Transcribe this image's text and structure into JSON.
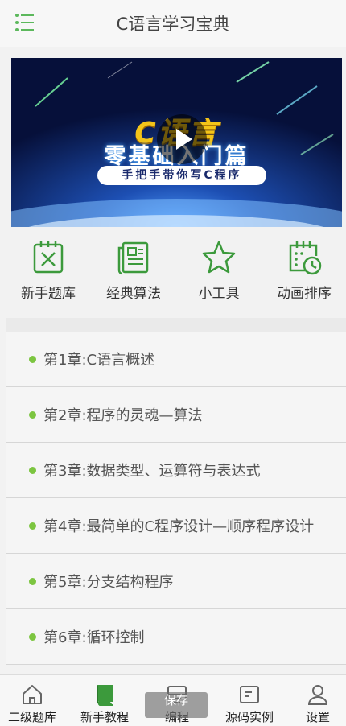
{
  "header": {
    "title": "C语言学习宝典",
    "menu_icon": "list-menu-icon"
  },
  "banner": {
    "logo_text": "C语言",
    "title": "零基础入门篇",
    "subtitle": "手把手带你写C程序",
    "play_icon": "play-icon"
  },
  "quick_links": [
    {
      "label": "新手题库",
      "icon": "question-bank-icon"
    },
    {
      "label": "经典算法",
      "icon": "document-icon"
    },
    {
      "label": "小工具",
      "icon": "star-icon"
    },
    {
      "label": "动画排序",
      "icon": "calendar-clock-icon"
    }
  ],
  "chapters": [
    {
      "label": "第1章:C语言概述"
    },
    {
      "label": "第2章:程序的灵魂—算法"
    },
    {
      "label": "第3章:数据类型、运算符与表达式"
    },
    {
      "label": "第4章:最简单的C程序设计—顺序程序设计"
    },
    {
      "label": "第5章:分支结构程序"
    },
    {
      "label": "第6章:循环控制"
    }
  ],
  "tabbar": {
    "tabs": [
      {
        "label": "二级题库",
        "icon": "home-icon"
      },
      {
        "label": "新手教程",
        "icon": "book-icon",
        "active": true
      },
      {
        "label": "编程",
        "icon": "monitor-icon"
      },
      {
        "label": "源码实例",
        "icon": "code-window-icon"
      },
      {
        "label": "设置",
        "icon": "user-icon"
      }
    ],
    "overlay_label": "保存"
  },
  "colors": {
    "accent": "#7cc540",
    "icon_green": "#3c9a3c"
  }
}
